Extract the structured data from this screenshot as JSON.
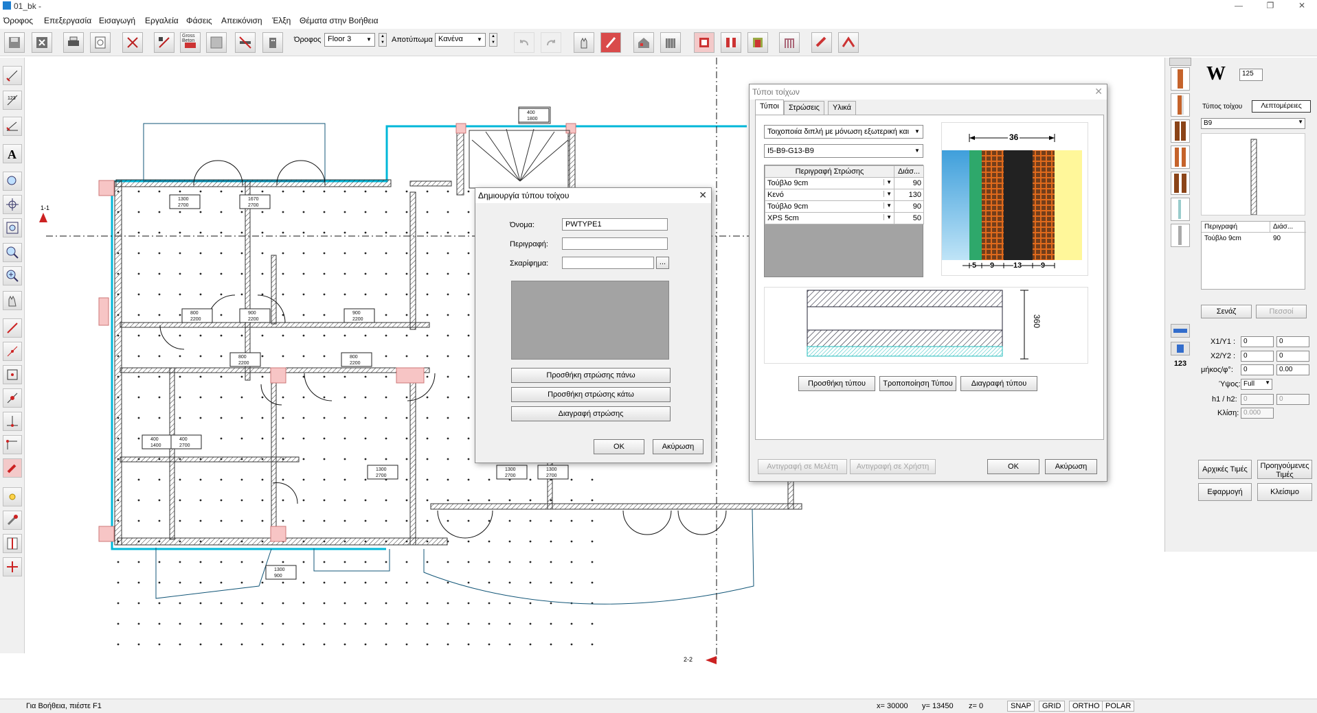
{
  "window": {
    "title": "01_bk -",
    "minimize": "—",
    "restore": "❐",
    "close": "✕"
  },
  "menu": [
    "Όροφος",
    "Επεξεργασία",
    "Εισαγωγή",
    "Εργαλεία",
    "Φάσεις",
    "Απεικόνιση",
    "Έλξη",
    "Θέματα στην Βοήθεια"
  ],
  "toolbar": {
    "floor_label": "Όροφος",
    "floor_value": "Floor 3",
    "print_label": "Αποτύπωμα",
    "print_value": "Κανένα",
    "gross_label": "Gross Beton"
  },
  "drawing": {
    "section_a": "1-1",
    "section_b": "2-2",
    "tags": [
      {
        "l1": "1300",
        "l2": "2700"
      },
      {
        "l1": "1670",
        "l2": "2700"
      },
      {
        "l1": "400",
        "l2": "1800"
      },
      {
        "l1": "800",
        "l2": "2200"
      },
      {
        "l1": "900",
        "l2": "2200"
      },
      {
        "l1": "900",
        "l2": "2200"
      },
      {
        "l1": "800",
        "l2": "2200"
      },
      {
        "l1": "800",
        "l2": "2200"
      },
      {
        "l1": "400",
        "l2": "1400"
      },
      {
        "l1": "400",
        "l2": "2700"
      },
      {
        "l1": "1300",
        "l2": "2700"
      },
      {
        "l1": "1300",
        "l2": "2700"
      },
      {
        "l1": "1300",
        "l2": "2700"
      },
      {
        "l1": "1300",
        "l2": "900"
      }
    ]
  },
  "create_dialog": {
    "title": "Δημιουργία τύπου τοίχου",
    "name_label": "Όνομα:",
    "name_value": "PWTYPE1",
    "description_label": "Περιγραφή:",
    "description_value": "",
    "sketch_label": "Σκαρίφημα:",
    "sketch_value": "",
    "browse": "...",
    "add_above": "Προσθήκη στρώσης πάνω",
    "add_below": "Προσθήκη στρώσης κάτω",
    "delete_layer": "Διαγραφή στρώσης",
    "ok": "OK",
    "cancel": "Ακύρωση"
  },
  "types_dialog": {
    "title": "Τύποι τοίχων",
    "tabs": [
      "Τύποι",
      "Στρώσεις",
      "Υλικά"
    ],
    "category": "Τοιχοποιία διπλή με μόνωση εξωτερική και",
    "type_code": "I5-B9-G13-B9",
    "col_desc": "Περιγραφή Στρώσης",
    "col_thick": "Διάσ...",
    "layers": [
      {
        "name": "Τούβλο 9cm",
        "thickness": "90"
      },
      {
        "name": "Κενό",
        "thickness": "130"
      },
      {
        "name": "Τούβλο 9cm",
        "thickness": "90"
      },
      {
        "name": "XPS 5cm",
        "thickness": "50"
      }
    ],
    "total_width": "36",
    "dims": [
      "5",
      "9",
      "13",
      "9"
    ],
    "height": "360",
    "add_type": "Προσθήκη τύπου",
    "modify_type": "Τροποποίηση Τύπου",
    "delete_type": "Διαγραφή  τύπου",
    "copy_study": "Αντιγραφή σε Μελέτη",
    "copy_user": "Αντιγραφή σε Χρήστη",
    "ok": "OK",
    "cancel": "Ακύρωση"
  },
  "right_panel": {
    "w_label": "W",
    "w_value": "125",
    "tab_type": "Τύπος τοίχου",
    "tab_details": "Λεπτομέρειες",
    "type_value": "B9",
    "col_desc": "Περιγραφή",
    "col_thick": "Διάσ...",
    "row_name": "Τούβλο 9cm",
    "row_thick": "90",
    "scenario": "Σενάζ",
    "lintel": "Πεσσοί",
    "x1y1_label": "X1/Y1 :",
    "x1": "0",
    "y1": "0",
    "x2y2_label": "X2/Y2 :",
    "x2": "0",
    "y2": "0",
    "len_label": "μήκος/φ°:",
    "len": "0",
    "angle": "0.00",
    "height_label": "Ύψος:",
    "height_value": "Full",
    "h1h2_label": "h1 / h2:",
    "h1": "0",
    "h2": "0",
    "slope_label": "Κλίση:",
    "slope": "0.000",
    "initial_values": "Αρχικές Τιμές",
    "previous_values_1": "Προηγούμενες",
    "previous_values_2": "Τιμές",
    "apply": "Εφαρμογή",
    "close": "Κλείσιμο",
    "counter": "123"
  },
  "status": {
    "help": "Για Βοήθεια, πιέστε F1",
    "x": "x=  30000",
    "y": "y=  13450",
    "z": "z=     0",
    "snap": "SNAP",
    "grid": "GRID",
    "ortho": "ORTHO",
    "polar": "POLAR"
  },
  "colors": {
    "wall_cyan": "#00b7d8",
    "wall_pink": "#f7c5c5",
    "brick": "#e06a1c",
    "insulation_green": "#2ea86b",
    "air_gap": "#222222",
    "plaster_yellow": "#fff79a",
    "sky_blue": "#5fb4e6"
  }
}
